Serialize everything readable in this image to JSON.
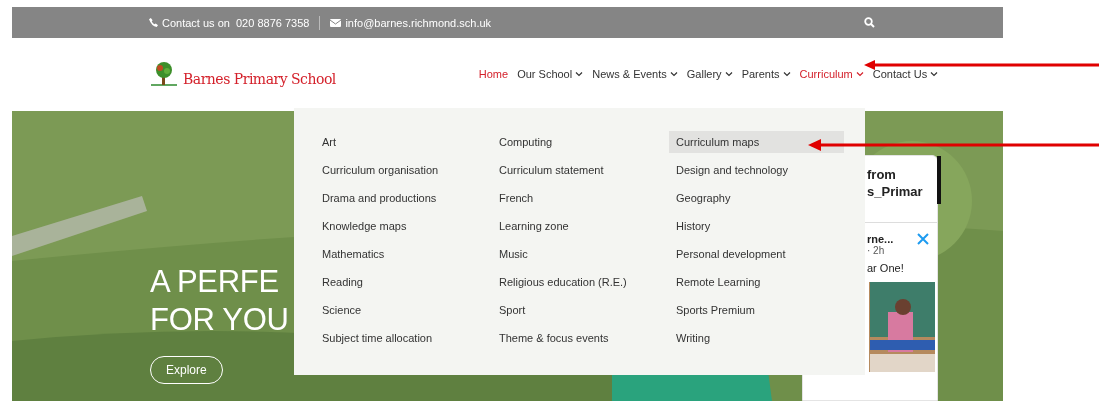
{
  "top_bar": {
    "phone_label": "Contact us on  020 8876 7358",
    "email": "info@barnes.richmond.sch.uk"
  },
  "header": {
    "school_name": "Barnes Primary School",
    "nav": [
      {
        "label": "Home",
        "selected": true,
        "dropdown": false
      },
      {
        "label": "Our School",
        "selected": false,
        "dropdown": true
      },
      {
        "label": "News & Events",
        "selected": false,
        "dropdown": true
      },
      {
        "label": "Gallery",
        "selected": false,
        "dropdown": true
      },
      {
        "label": "Parents",
        "selected": false,
        "dropdown": true
      },
      {
        "label": "Curriculum",
        "selected": true,
        "dropdown": true
      },
      {
        "label": "Contact Us",
        "selected": false,
        "dropdown": true
      }
    ]
  },
  "hero": {
    "headline": [
      "A PERFE",
      "FOR YOU"
    ],
    "button": "Explore"
  },
  "curriculum_menu": {
    "columns": [
      [
        {
          "label": "Art",
          "selected": false
        },
        {
          "label": "Curriculum organisation",
          "selected": false
        },
        {
          "label": "Drama and productions",
          "selected": false
        },
        {
          "label": "Knowledge maps",
          "selected": false
        },
        {
          "label": "Mathematics",
          "selected": false
        },
        {
          "label": "Reading",
          "selected": false
        },
        {
          "label": "Science",
          "selected": false
        },
        {
          "label": "Subject time allocation",
          "selected": false
        }
      ],
      [
        {
          "label": "Computing",
          "selected": false
        },
        {
          "label": "Curriculum statement",
          "selected": false
        },
        {
          "label": "French",
          "selected": false
        },
        {
          "label": "Learning zone",
          "selected": false
        },
        {
          "label": "Music",
          "selected": false
        },
        {
          "label": "Religious education (R.E.)",
          "selected": false
        },
        {
          "label": "Sport",
          "selected": false
        },
        {
          "label": "Theme & focus events",
          "selected": false
        }
      ],
      [
        {
          "label": "Curriculum maps",
          "selected": true
        },
        {
          "label": "Design and technology",
          "selected": false
        },
        {
          "label": "Geography",
          "selected": false
        },
        {
          "label": "History",
          "selected": false
        },
        {
          "label": "Personal development",
          "selected": false
        },
        {
          "label": "Remote Learning",
          "selected": false
        },
        {
          "label": "Sports Premium",
          "selected": false
        },
        {
          "label": "Writing",
          "selected": false
        }
      ]
    ]
  },
  "twitter_panel": {
    "title_lines": [
      "from",
      "s_Primar"
    ],
    "author": "rne...",
    "meta": "· 2h",
    "text": "ar One!"
  }
}
